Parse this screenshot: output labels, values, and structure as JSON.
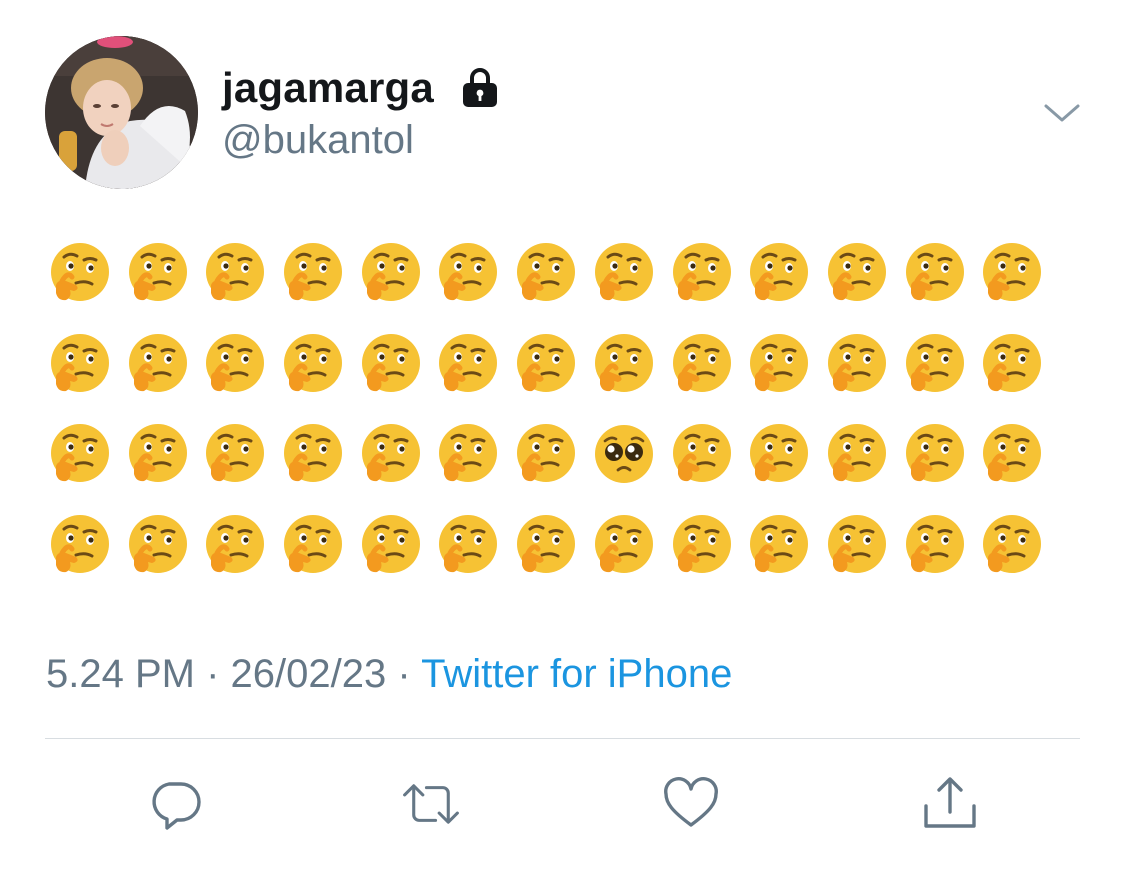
{
  "tweet": {
    "display_name": "jagamarga",
    "handle": "@bukantol",
    "protected_icon": "lock-icon",
    "menu_icon": "chevron-down-icon",
    "emoji_rows": [
      [
        "thinking",
        "thinking",
        "thinking",
        "thinking",
        "thinking",
        "thinking",
        "thinking",
        "thinking",
        "thinking",
        "thinking",
        "thinking",
        "thinking",
        "thinking"
      ],
      [
        "thinking",
        "thinking",
        "thinking",
        "thinking",
        "thinking",
        "thinking",
        "thinking",
        "thinking",
        "thinking",
        "thinking",
        "thinking",
        "thinking",
        "thinking"
      ],
      [
        "thinking",
        "thinking",
        "thinking",
        "thinking",
        "thinking",
        "thinking",
        "thinking",
        "pleading",
        "thinking",
        "thinking",
        "thinking",
        "thinking",
        "thinking"
      ],
      [
        "thinking",
        "thinking",
        "thinking",
        "thinking",
        "thinking",
        "thinking",
        "thinking",
        "thinking",
        "thinking",
        "thinking",
        "thinking",
        "thinking",
        "thinking"
      ]
    ],
    "time": "5.24 PM",
    "date": "26/02/23",
    "separator": "·",
    "source": "Twitter for iPhone"
  },
  "actions": [
    {
      "name": "reply-button",
      "icon": "reply-icon"
    },
    {
      "name": "retweet-button",
      "icon": "retweet-icon"
    },
    {
      "name": "like-button",
      "icon": "heart-icon"
    },
    {
      "name": "share-button",
      "icon": "share-icon"
    }
  ],
  "colors": {
    "text_primary": "#14171a",
    "text_secondary": "#657786",
    "link": "#1b95e0",
    "divider": "#d8dde1",
    "emoji_face": "#f6c234",
    "emoji_hand": "#f39a1f"
  }
}
